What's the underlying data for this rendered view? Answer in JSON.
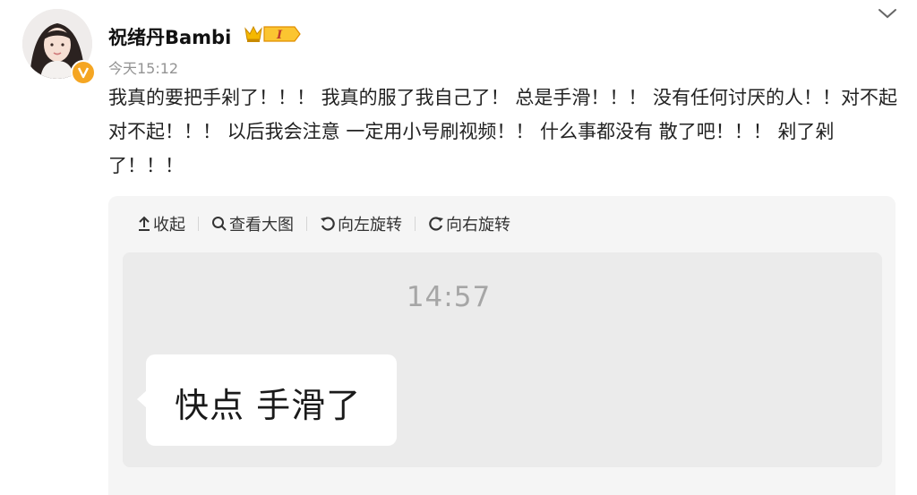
{
  "user": {
    "name": "祝绪丹Bambi",
    "vip_level": "I",
    "verified_badge": "V",
    "avatar_icon": "user-avatar-photo",
    "badge_color": "#f5a623",
    "vip_color": "#f5b800"
  },
  "post": {
    "timestamp": "今天15:12",
    "text": "我真的要把手剁了！！！ 我真的服了我自己了！ 总是手滑！！！ 没有任何讨厌的人！！对不起对不起！！！ 以后我会注意 一定用小号刷视频！！ 什么事都没有 散了吧！！！ 剁了剁了！！！"
  },
  "media": {
    "toolbar": {
      "collapse_label": "收起",
      "view_large_label": "查看大图",
      "rotate_left_label": "向左旋转",
      "rotate_right_label": "向右旋转"
    },
    "image": {
      "chat_time": "14:57",
      "bubble_text": "快点 手滑了"
    }
  },
  "icons": {
    "more": "chevron-down-icon",
    "collapse": "arrow-up-icon",
    "view_large": "search-icon",
    "rotate_left": "rotate-left-icon",
    "rotate_right": "rotate-right-icon"
  }
}
